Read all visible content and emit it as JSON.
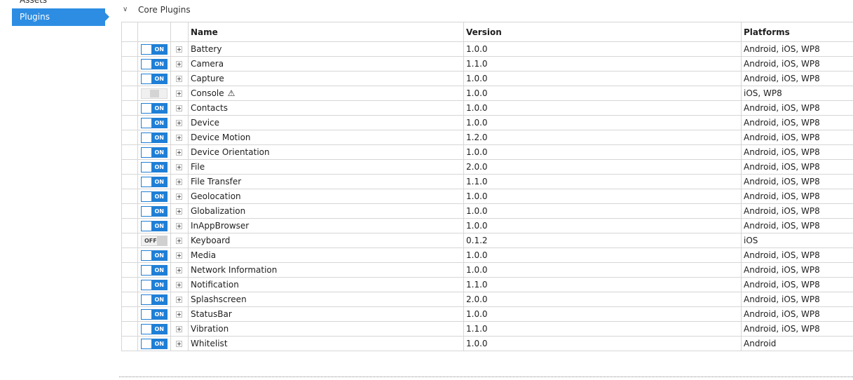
{
  "sidebar": {
    "assets_label": "Assets",
    "plugins_label": "Plugins"
  },
  "section": {
    "title": "Core Plugins"
  },
  "columns": {
    "name": "Name",
    "version": "Version",
    "platforms": "Platforms"
  },
  "toggle_labels": {
    "on": "ON",
    "off": "OFF"
  },
  "colors": {
    "accent": "#2d8de2",
    "toggle_on": "#1f7fd6"
  },
  "plugins": [
    {
      "state": "on",
      "name": "Battery",
      "version": "1.0.0",
      "platforms": "Android, iOS, WP8"
    },
    {
      "state": "on",
      "name": "Camera",
      "version": "1.1.0",
      "platforms": "Android, iOS, WP8"
    },
    {
      "state": "on",
      "name": "Capture",
      "version": "1.0.0",
      "platforms": "Android, iOS, WP8"
    },
    {
      "state": "disabled",
      "name": "Console",
      "version": "1.0.0",
      "platforms": "iOS, WP8",
      "warning": true
    },
    {
      "state": "on",
      "name": "Contacts",
      "version": "1.0.0",
      "platforms": "Android, iOS, WP8"
    },
    {
      "state": "on",
      "name": "Device",
      "version": "1.0.0",
      "platforms": "Android, iOS, WP8"
    },
    {
      "state": "on",
      "name": "Device Motion",
      "version": "1.2.0",
      "platforms": "Android, iOS, WP8"
    },
    {
      "state": "on",
      "name": "Device Orientation",
      "version": "1.0.0",
      "platforms": "Android, iOS, WP8"
    },
    {
      "state": "on",
      "name": "File",
      "version": "2.0.0",
      "platforms": "Android, iOS, WP8"
    },
    {
      "state": "on",
      "name": "File Transfer",
      "version": "1.1.0",
      "platforms": "Android, iOS, WP8"
    },
    {
      "state": "on",
      "name": "Geolocation",
      "version": "1.0.0",
      "platforms": "Android, iOS, WP8"
    },
    {
      "state": "on",
      "name": "Globalization",
      "version": "1.0.0",
      "platforms": "Android, iOS, WP8"
    },
    {
      "state": "on",
      "name": "InAppBrowser",
      "version": "1.0.0",
      "platforms": "Android, iOS, WP8"
    },
    {
      "state": "off",
      "name": "Keyboard",
      "version": "0.1.2",
      "platforms": "iOS"
    },
    {
      "state": "on",
      "name": "Media",
      "version": "1.0.0",
      "platforms": "Android, iOS, WP8"
    },
    {
      "state": "on",
      "name": "Network Information",
      "version": "1.0.0",
      "platforms": "Android, iOS, WP8"
    },
    {
      "state": "on",
      "name": "Notification",
      "version": "1.1.0",
      "platforms": "Android, iOS, WP8"
    },
    {
      "state": "on",
      "name": "Splashscreen",
      "version": "2.0.0",
      "platforms": "Android, iOS, WP8"
    },
    {
      "state": "on",
      "name": "StatusBar",
      "version": "1.0.0",
      "platforms": "Android, iOS, WP8"
    },
    {
      "state": "on",
      "name": "Vibration",
      "version": "1.1.0",
      "platforms": "Android, iOS, WP8"
    },
    {
      "state": "on",
      "name": "Whitelist",
      "version": "1.0.0",
      "platforms": "Android"
    }
  ]
}
